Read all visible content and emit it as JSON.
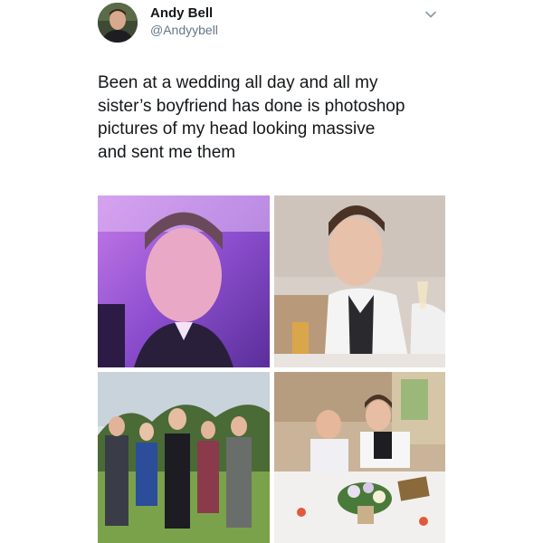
{
  "author": {
    "name": "Andy Bell",
    "handle": "@Andyybell",
    "avatar_icon": "profile-avatar"
  },
  "tweet": {
    "lines": [
      "Been at a wedding all day and all my",
      "sister’s boyfriend has done is photoshop",
      "pictures of my head looking massive",
      "and sent me them"
    ]
  },
  "menu_icon": "chevron-down-icon",
  "photos": [
    {
      "id": "purple-room-closeup"
    },
    {
      "id": "table-with-wine-glass"
    },
    {
      "id": "group-outdoor-lawn"
    },
    {
      "id": "reception-table-flowers"
    }
  ],
  "colors": {
    "text": "#14171a",
    "secondary": "#657786",
    "background": "#ffffff"
  }
}
